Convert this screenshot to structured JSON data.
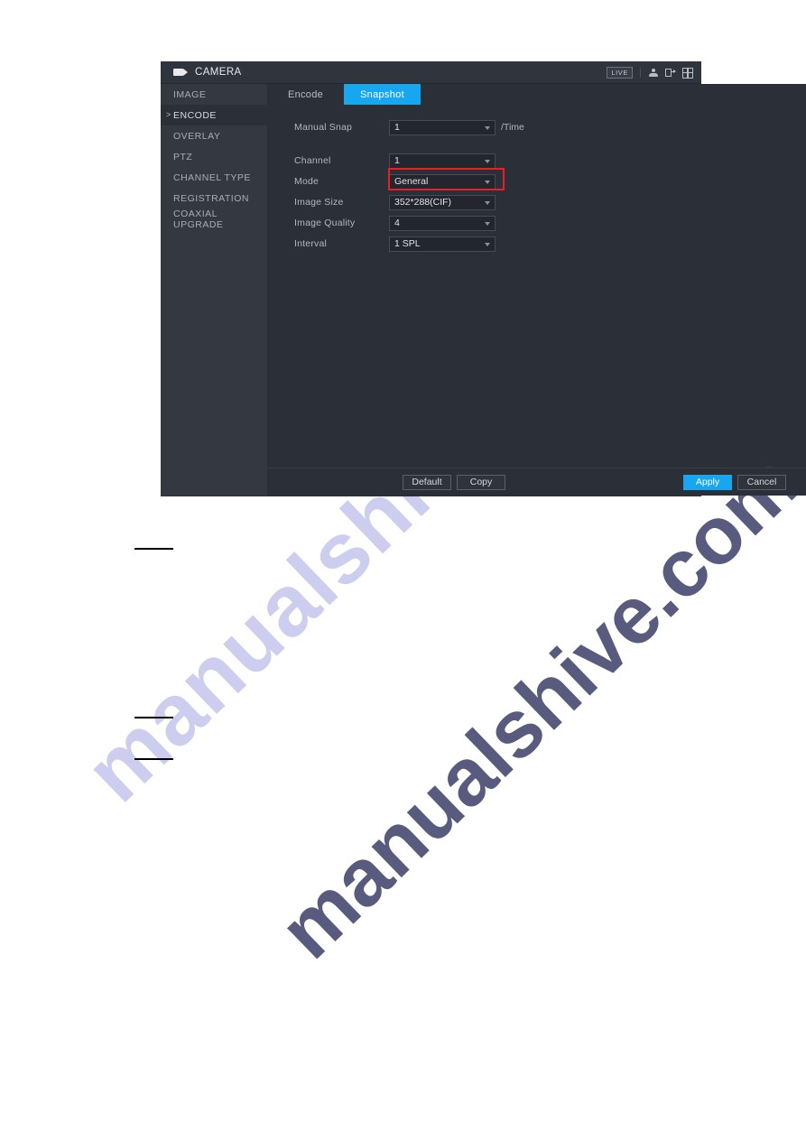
{
  "page": {
    "watermark": "manualshive.com",
    "rules_count": 3
  },
  "dialog": {
    "titlebar": {
      "camera_icon": "video-camera-icon",
      "title": "CAMERA",
      "live_badge": "LIVE",
      "icons": [
        {
          "name": "user-icon"
        },
        {
          "name": "logout-icon"
        },
        {
          "name": "grid-view-icon"
        }
      ]
    },
    "sidebar": {
      "items": [
        {
          "label": "IMAGE",
          "active": false
        },
        {
          "label": "ENCODE",
          "active": true
        },
        {
          "label": "OVERLAY",
          "active": false
        },
        {
          "label": "PTZ",
          "active": false
        },
        {
          "label": "CHANNEL TYPE",
          "active": false
        },
        {
          "label": "REGISTRATION",
          "active": false
        },
        {
          "label": "COAXIAL UPGRADE",
          "active": false
        }
      ],
      "active_marker": ">"
    },
    "tabs": [
      {
        "label": "Encode",
        "active": false
      },
      {
        "label": "Snapshot",
        "active": true
      }
    ],
    "form": {
      "manual_snap": {
        "label": "Manual Snap",
        "value": "1",
        "suffix": "/Time"
      },
      "channel": {
        "label": "Channel",
        "value": "1"
      },
      "mode": {
        "label": "Mode",
        "value": "General",
        "highlighted": true,
        "highlight_color": "#ee1c24"
      },
      "image_size": {
        "label": "Image Size",
        "value": "352*288(CIF)"
      },
      "image_quality": {
        "label": "Image Quality",
        "value": "4"
      },
      "interval": {
        "label": "Interval",
        "value": "1 SPL"
      }
    },
    "footer": {
      "default_label": "Default",
      "copy_label": "Copy",
      "apply_label": "Apply",
      "cancel_label": "Cancel",
      "accent_color": "#16a7f0"
    },
    "watermark": "manualshive.com"
  }
}
